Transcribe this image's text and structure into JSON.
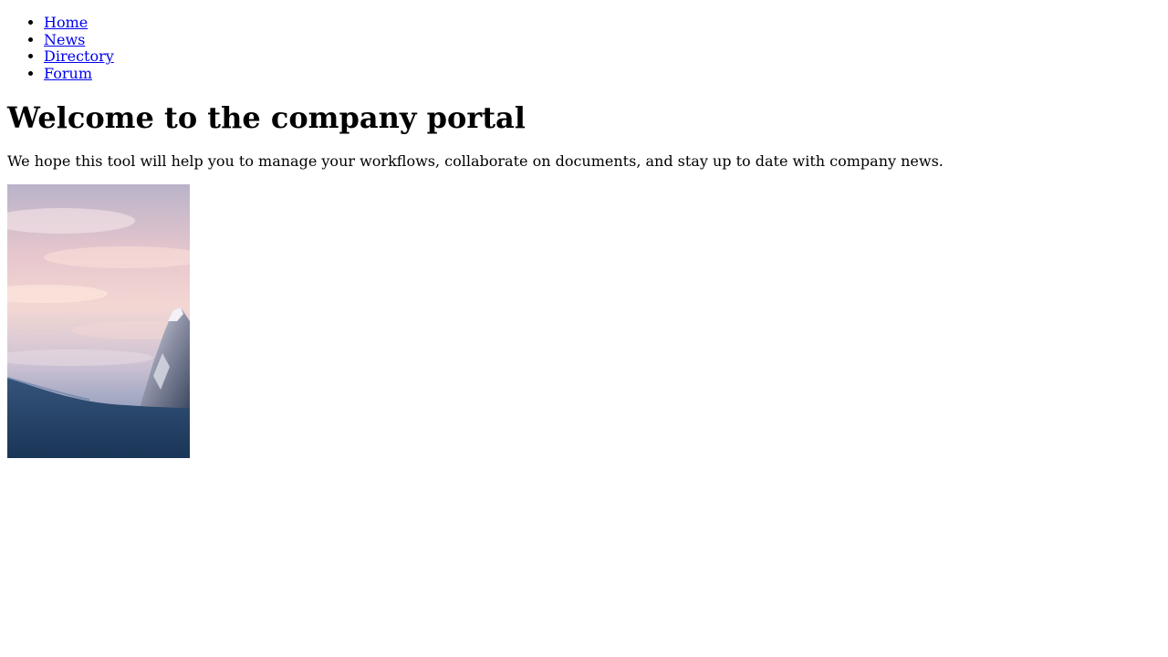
{
  "nav": {
    "items": [
      {
        "label": "Home"
      },
      {
        "label": "News"
      },
      {
        "label": "Directory"
      },
      {
        "label": "Forum"
      }
    ]
  },
  "main": {
    "title": "Welcome to the company portal",
    "intro": "We hope this tool will help you to manage your workflows, collaborate on documents, and stay up to date with company news."
  },
  "colors": {
    "link": "#0000ee",
    "text": "#000000",
    "background": "#ffffff"
  }
}
